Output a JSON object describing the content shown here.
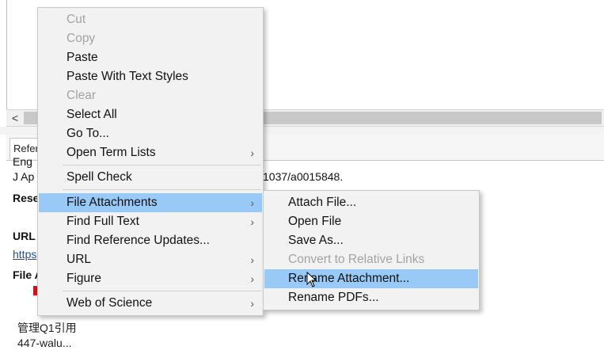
{
  "scrollbar": {
    "left_arrow": "<"
  },
  "tab": {
    "label": "Refer"
  },
  "reference": {
    "line_top": "Eng",
    "line_journal": "J Ap",
    "line_doi_tail": "1037/a0015848.",
    "label_research": "Rese",
    "label_url": "URL",
    "url_link": "https",
    "label_file": "File A"
  },
  "status": {
    "line1": "管理Q1引用",
    "line2": "447-walu..."
  },
  "context_menu": {
    "items": [
      {
        "label": "Cut",
        "disabled": true
      },
      {
        "label": "Copy",
        "disabled": true
      },
      {
        "label": "Paste"
      },
      {
        "label": "Paste With Text Styles"
      },
      {
        "label": "Clear",
        "disabled": true
      },
      {
        "label": "Select All"
      },
      {
        "label": "Go To..."
      },
      {
        "label": "Open Term Lists",
        "submenu": true
      },
      {
        "label": "Spell Check"
      },
      {
        "label": "File Attachments",
        "submenu": true,
        "highlighted": true
      },
      {
        "label": "Find Full Text",
        "submenu": true
      },
      {
        "label": "Find Reference Updates..."
      },
      {
        "label": "URL",
        "submenu": true
      },
      {
        "label": "Figure",
        "submenu": true
      },
      {
        "label": "Web of Science",
        "submenu": true
      }
    ],
    "submenu_arrow": "›"
  },
  "submenu": {
    "items": [
      {
        "label": "Attach File..."
      },
      {
        "label": "Open File"
      },
      {
        "label": "Save As..."
      },
      {
        "label": "Convert to Relative Links",
        "disabled": true
      },
      {
        "label": "Rename Attachment...",
        "highlighted": true
      },
      {
        "label": "Rename PDFs..."
      }
    ]
  },
  "colors": {
    "highlight": "#99c9f7",
    "menu_bg": "#f2f2f2",
    "disabled_text": "#a3a3a3",
    "link": "#1a4fa0",
    "attachment_marker": "#c41a1a"
  },
  "icons": {
    "cursor": "mouse-pointer-icon",
    "scroll_left": "chevron-left-icon"
  }
}
